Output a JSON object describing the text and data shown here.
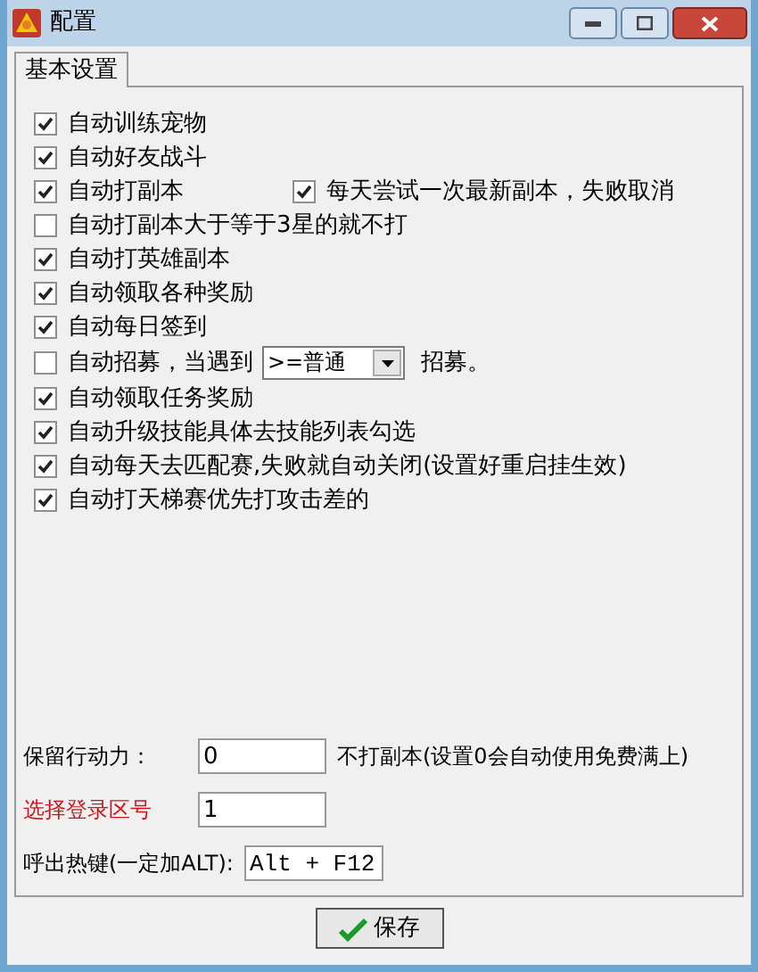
{
  "window": {
    "title": "配置"
  },
  "tabs": [
    {
      "label": "基本设置",
      "selected": true
    }
  ],
  "options": [
    {
      "kind": "checkbox",
      "label": "自动训练宠物",
      "checked": true
    },
    {
      "kind": "checkbox",
      "label": "自动好友战斗",
      "checked": true
    },
    {
      "kind": "pair",
      "label": "自动打副本",
      "checked": true,
      "extra": {
        "label": "每天尝试一次最新副本，失败取消",
        "checked": true
      }
    },
    {
      "kind": "checkbox",
      "label": "自动打副本大于等于3星的就不打",
      "checked": false
    },
    {
      "kind": "checkbox",
      "label": "自动打英雄副本",
      "checked": true
    },
    {
      "kind": "checkbox",
      "label": "自动领取各种奖励",
      "checked": true
    },
    {
      "kind": "checkbox",
      "label": "自动每日签到",
      "checked": true
    },
    {
      "kind": "dropdown",
      "label": "自动招募，当遇到",
      "checked": false,
      "value": ">=普通",
      "suffix": "招募。"
    },
    {
      "kind": "checkbox",
      "label": "自动领取任务奖励",
      "checked": true
    },
    {
      "kind": "checkbox",
      "label": "自动升级技能具体去技能列表勾选",
      "checked": true
    },
    {
      "kind": "checkbox",
      "label": "自动每天去匹配赛,失败就自动关闭(设置好重启挂生效)",
      "checked": true
    },
    {
      "kind": "checkbox",
      "label": "自动打天梯赛优先打攻击差的",
      "checked": true
    }
  ],
  "fields": [
    {
      "label": "保留行动力：",
      "value": "0",
      "note": "不打副本(设置0会自动使用免费满上)",
      "highlight": false
    },
    {
      "label": "选择登录区号",
      "value": "1",
      "highlight": true
    },
    {
      "label": "呼出热键(一定加ALT):",
      "value": "Alt + F12",
      "highlight": false,
      "mono": true
    }
  ],
  "buttons": [
    {
      "label": "保存"
    }
  ]
}
